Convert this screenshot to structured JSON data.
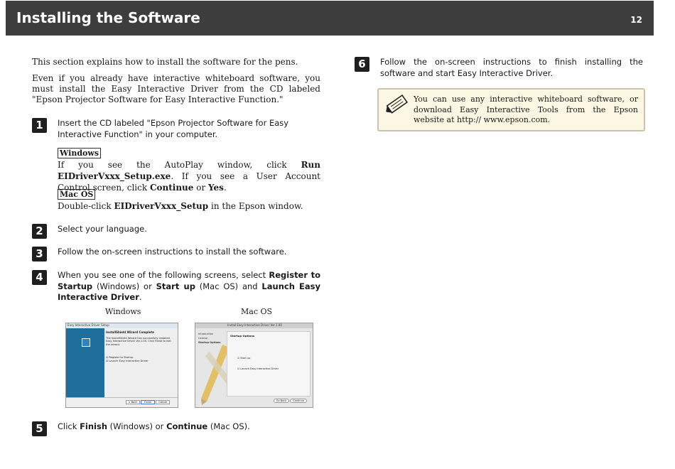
{
  "header": {
    "title": "Installing the Software",
    "page_number": "12"
  },
  "intro": {
    "p1": "This section explains how to install the software for the pens.",
    "p2": "Even if you already have interactive whiteboard software, you must install the Easy Interactive Driver from the CD labeled \"Epson Projector Software for Easy Interactive Function.\""
  },
  "steps": {
    "s1": {
      "num": "1",
      "text": "Insert the CD labeled \"Epson Projector Software for Easy Interactive Function\" in your computer.",
      "windows_label": "Windows",
      "windows_t1": "If you see the AutoPlay window, click ",
      "windows_b1": "Run EIDriverVxxx_Setup.exe",
      "windows_t2": ". If you see a User Account Control screen, click ",
      "windows_b2": "Continue",
      "windows_t3": " or ",
      "windows_b3": "Yes",
      "windows_t4": ".",
      "mac_label": "Mac OS",
      "mac_t1": "Double-click ",
      "mac_b1": "EIDriverVxxx_Setup",
      "mac_t2": " in the Epson window."
    },
    "s2": {
      "num": "2",
      "text": "Select your language."
    },
    "s3": {
      "num": "3",
      "text": "Follow the on-screen instructions to install the software."
    },
    "s4": {
      "num": "4",
      "t1": "When you see one of the following screens, select ",
      "b1": "Register to Startup",
      "t2": " (Windows) or ",
      "b2": "Start up",
      "t3": " (Mac OS) and ",
      "b3": "Launch Easy Interactive Driver",
      "t4": ".",
      "caption_windows": "Windows",
      "caption_mac": "Mac OS"
    },
    "s5": {
      "num": "5",
      "t1": "Click ",
      "b1": "Finish",
      "t2": " (Windows) or ",
      "b2": "Continue",
      "t3": " (Mac OS)."
    },
    "s6": {
      "num": "6",
      "text": "Follow the on-screen instructions to finish installing the software and start Easy Interactive Driver."
    }
  },
  "note": {
    "text": "You can use any interactive whiteboard software, or download Easy Interactive Tools from the Epson website at http:// www.epson.com.",
    "icon": "note-pencil-icon"
  },
  "win_shot": {
    "title": "Easy Interactive Driver Setup",
    "heading": "InstallShield Wizard Complete",
    "body": "The InstallShield Wizard has successfully installed Easy Interactive Driver Ver.1.00. Click Finish to exit the wizard.",
    "opt1": "Register to Startup",
    "opt2": "Launch Easy Interactive Driver",
    "btn_back": "< Back",
    "btn_finish": "Finish",
    "btn_cancel": "Cancel"
  },
  "mac_shot": {
    "title": "Install Easy Interactive Driver Ver.1.00",
    "heading": "Startup Options",
    "side1": "Introduction",
    "side2": "License",
    "side3": "Startup Options",
    "opt1": "Start up",
    "opt2": "Launch Easy Interactive Driver",
    "btn_back": "Go Back",
    "btn_continue": "Continue"
  },
  "colors": {
    "header_bg": "#3d3d3d",
    "note_bg": "#fbf7e2",
    "win_blue": "#1f6f9c"
  }
}
